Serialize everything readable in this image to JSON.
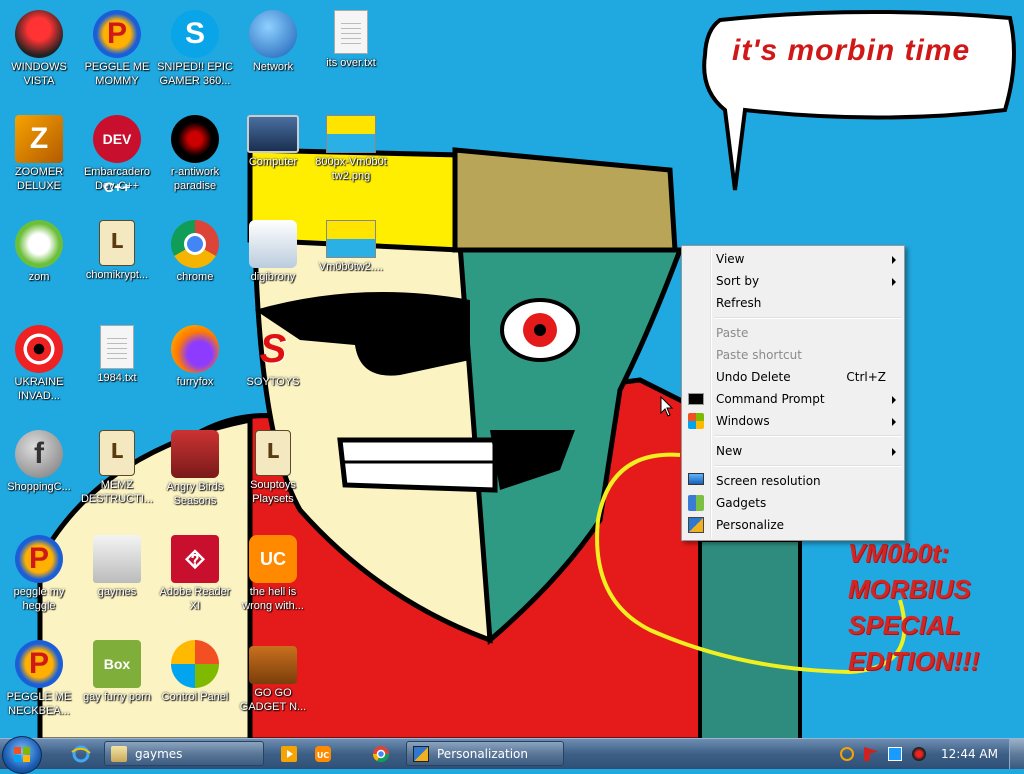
{
  "wallpaper": {
    "speech_bubble_text": "it's morbin time",
    "edition_text": "VM0b0t: MORBIUS SPECIAL EDITION!!!"
  },
  "desktop_icons": [
    {
      "label": "WINDOWS VISTA",
      "icon": "windows-vista-icon"
    },
    {
      "label": "PEGGLE ME MOMMY",
      "icon": "peggle-icon"
    },
    {
      "label": "SNIPED!! EPIC GAMER 360...",
      "icon": "skype-icon"
    },
    {
      "label": "Network",
      "icon": "network-icon"
    },
    {
      "label": "its over.txt",
      "icon": "text-file-icon"
    },
    {
      "label": "ZOOMER DELUXE",
      "icon": "zuma-icon"
    },
    {
      "label": "Embarcadero Dev-C++",
      "icon": "devcpp-icon"
    },
    {
      "label": "r-antiwork paradise",
      "icon": "antiwork-icon"
    },
    {
      "label": "Computer",
      "icon": "computer-icon"
    },
    {
      "label": "800px-Vm0b0t tw2.png",
      "icon": "image-file-icon"
    },
    {
      "label": "zom",
      "icon": "plants-vs-zombies-icon"
    },
    {
      "label": "chomikrypt...",
      "icon": "hourglass-app-icon"
    },
    {
      "label": "chrome",
      "icon": "chrome-icon"
    },
    {
      "label": "digibrony",
      "icon": "user-folder-icon"
    },
    {
      "label": "Vm0b0tw2....",
      "icon": "image-file-icon"
    },
    {
      "label": "UKRAINE INVAD...",
      "icon": "radiation-icon"
    },
    {
      "label": "1984.txt",
      "icon": "text-file-icon"
    },
    {
      "label": "furryfox",
      "icon": "firefox-icon"
    },
    {
      "label": "SOYTOYS",
      "icon": "soytoys-icon"
    },
    {
      "label": "ShoppingC...",
      "icon": "flash-icon"
    },
    {
      "label": "MEMZ DESTRUCTI...",
      "icon": "hourglass-app-icon"
    },
    {
      "label": "Angry Birds Seasons",
      "icon": "angry-birds-icon"
    },
    {
      "label": "Souptoys Playsets",
      "icon": "hourglass-app-icon"
    },
    {
      "label": "peggle my heggle",
      "icon": "peggle-icon"
    },
    {
      "label": "gaymes",
      "icon": "folder-icon"
    },
    {
      "label": "Adobe Reader XI",
      "icon": "adobe-reader-icon"
    },
    {
      "label": "the hell is wrong with...",
      "icon": "uc-browser-icon"
    },
    {
      "label": "PEGGLE ME NECKBEA...",
      "icon": "peggle-icon"
    },
    {
      "label": "gay furry porn",
      "icon": "box-game-icon"
    },
    {
      "label": "Control Panel",
      "icon": "control-panel-icon"
    },
    {
      "label": "GO GO GADGET N...",
      "icon": "briefcase-icon"
    }
  ],
  "context_menu": {
    "view": "View",
    "sort_by": "Sort by",
    "refresh": "Refresh",
    "paste": "Paste",
    "paste_shortcut": "Paste shortcut",
    "undo_delete": "Undo Delete",
    "undo_shortcut": "Ctrl+Z",
    "command_prompt": "Command Prompt",
    "windows": "Windows",
    "new": "New",
    "screen_resolution": "Screen resolution",
    "gadgets": "Gadgets",
    "personalize": "Personalize"
  },
  "taskbar": {
    "buttons": [
      {
        "label": "gaymes",
        "icon": "folder-icon"
      },
      {
        "label": "Personalization",
        "icon": "personalization-icon"
      }
    ],
    "quick_launch": [
      "internet-explorer-icon",
      "media-player-icon",
      "uc-browser-icon",
      "chrome-icon"
    ],
    "clock": "12:44 AM"
  },
  "colors": {
    "desktop_bg": "#20a8e0",
    "menu_bg": "#f0f0f0",
    "disabled_text": "#8b8b8b",
    "wallpaper_text_red": "#d01818"
  }
}
